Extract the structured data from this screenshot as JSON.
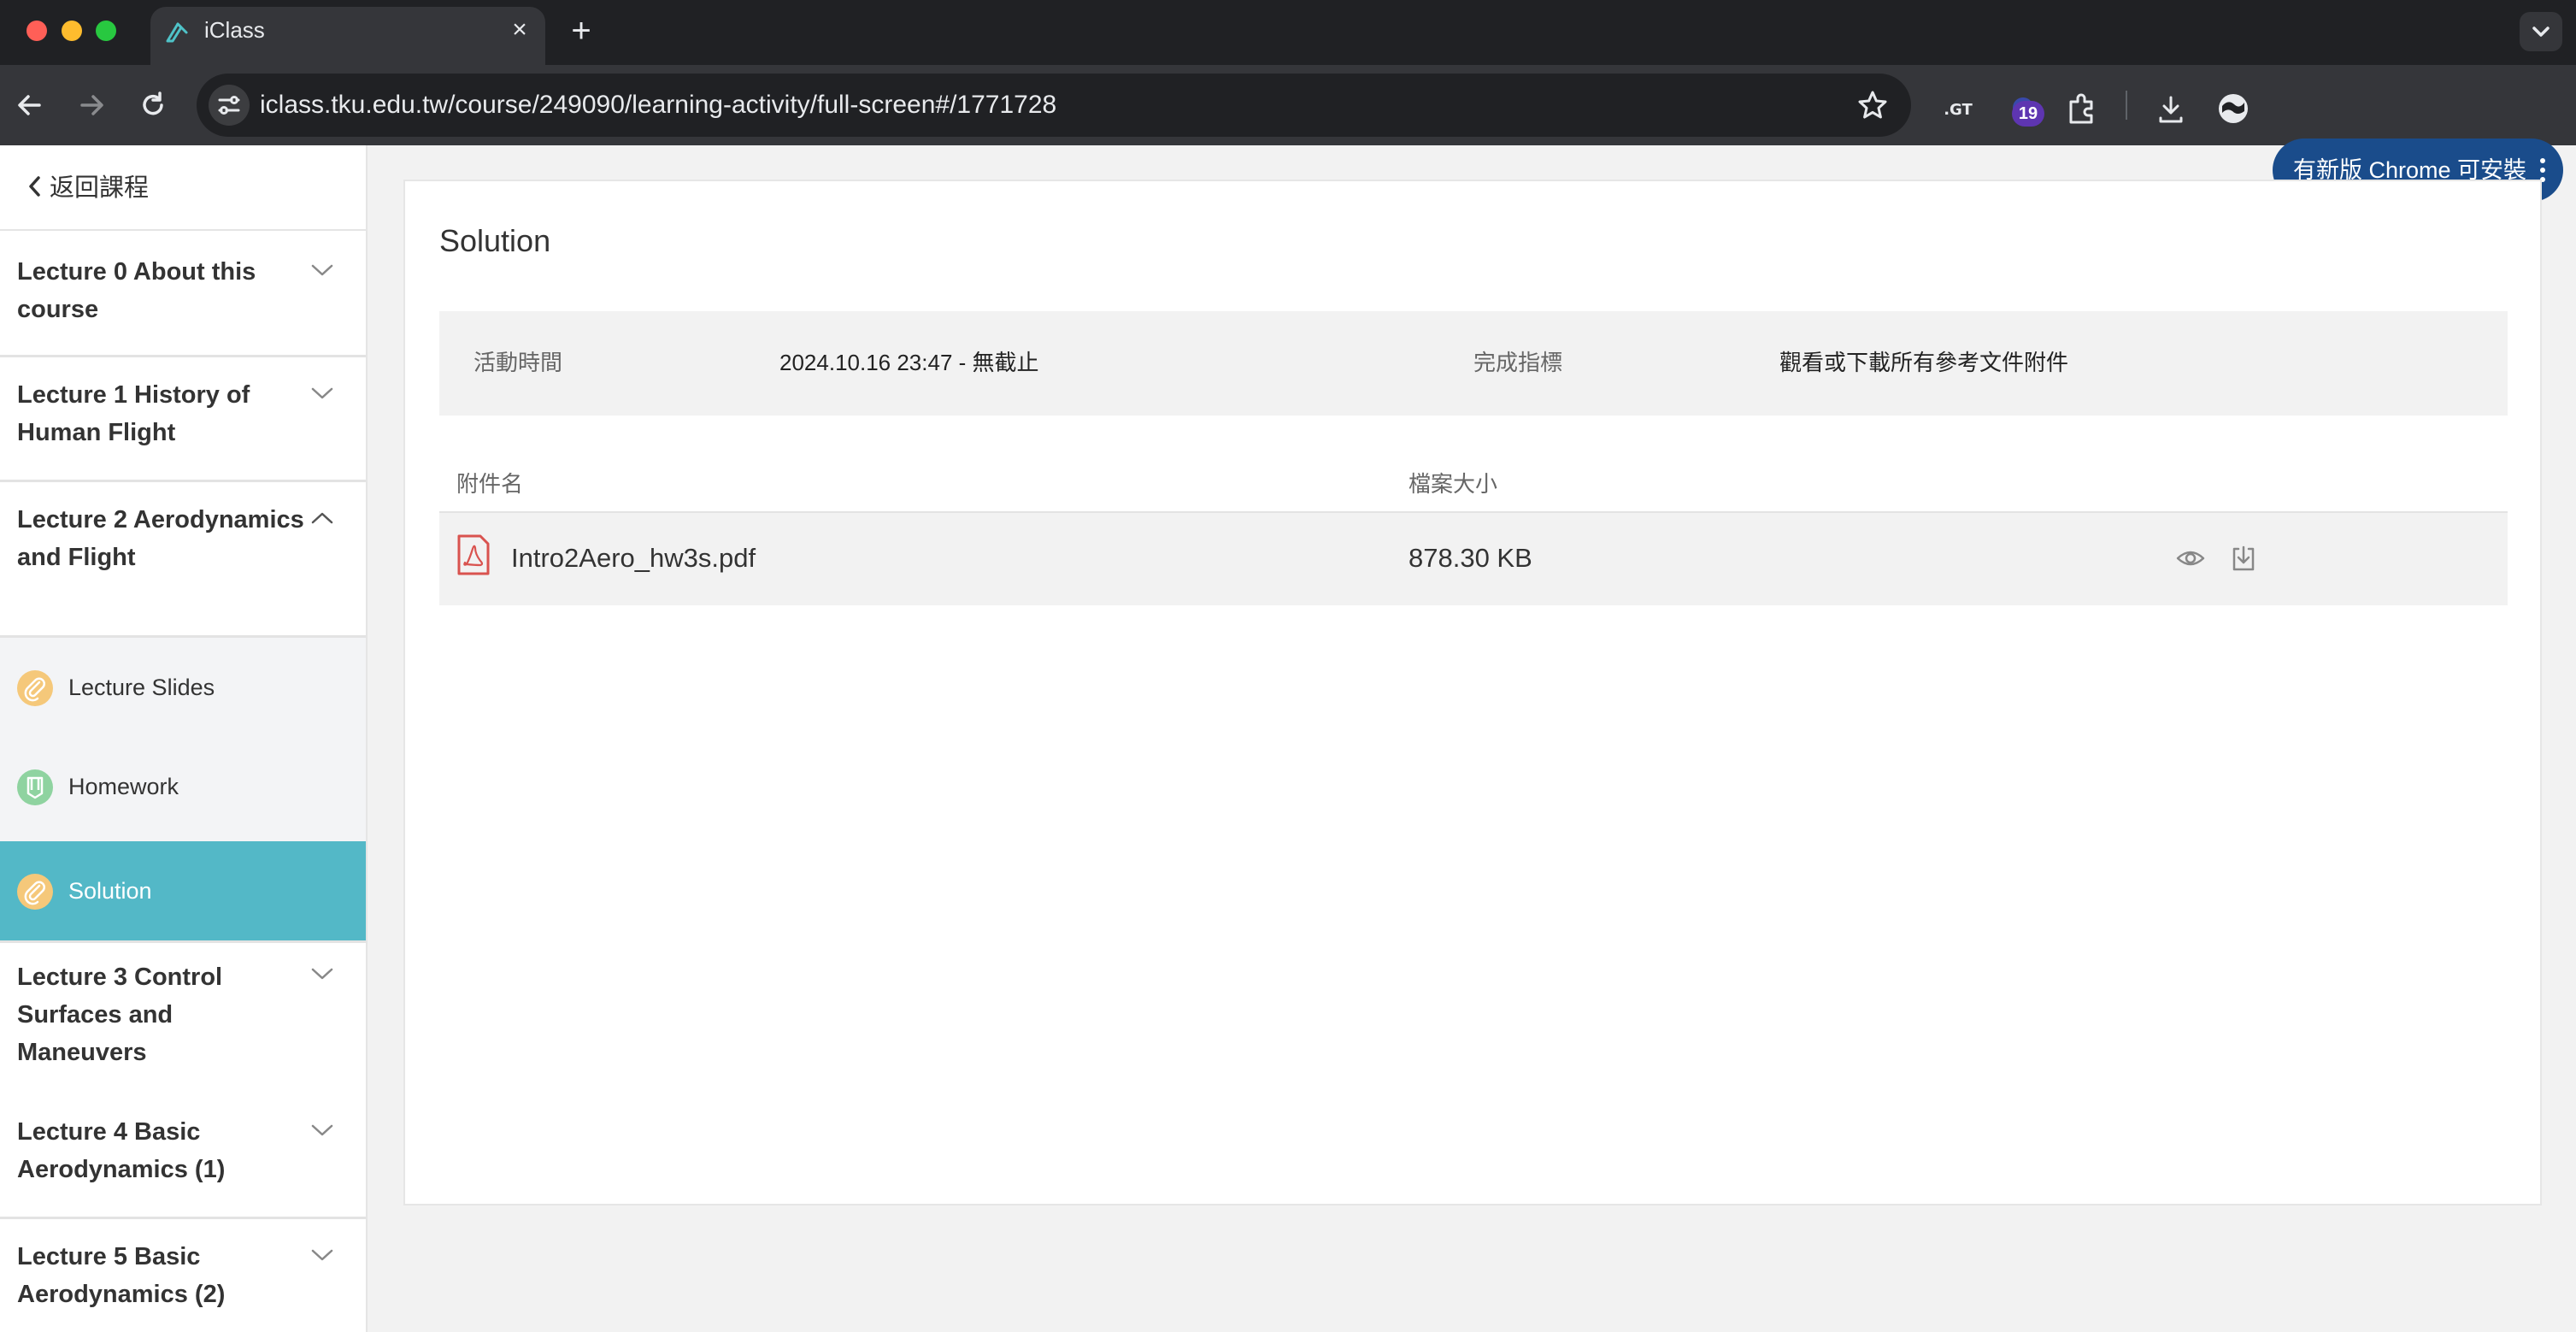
{
  "browser": {
    "tab_title": "iClass",
    "url": "iclass.tku.edu.tw/course/249090/learning-activity/full-screen#/1771728",
    "extension_badge": "19",
    "update_button": "有新版 Chrome 可安裝"
  },
  "sidebar": {
    "back_label": "返回課程",
    "lectures": [
      {
        "title": "Lecture 0 About this course",
        "expanded": false
      },
      {
        "title": "Lecture 1 History of Human Flight",
        "expanded": false
      },
      {
        "title": "Lecture 2 Aerodynamics and Flight",
        "expanded": true,
        "activities": [
          {
            "label": "Lecture Slides",
            "icon": "paperclip-icon",
            "active": false
          },
          {
            "label": "Homework",
            "icon": "homework-icon",
            "active": false
          },
          {
            "label": "Solution",
            "icon": "paperclip-icon",
            "active": true
          }
        ]
      },
      {
        "title": "Lecture 3 Control Surfaces and Maneuvers",
        "expanded": false
      },
      {
        "title": "Lecture 4 Basic Aerodynamics (1)",
        "expanded": false
      },
      {
        "title": "Lecture 5 Basic Aerodynamics (2)",
        "expanded": false
      }
    ]
  },
  "main": {
    "title": "Solution",
    "info": {
      "time_label": "活動時間",
      "time_value": "2024.10.16 23:47 - 無截止",
      "criteria_label": "完成指標",
      "criteria_value": "觀看或下載所有參考文件附件"
    },
    "table": {
      "headers": [
        "附件名",
        "檔案大小"
      ],
      "rows": [
        {
          "name": "Intro2Aero_hw3s.pdf",
          "size": "878.30 KB"
        }
      ]
    }
  },
  "colors": {
    "accent": "#53b8c7",
    "pdf_red": "#d9534f",
    "paperclip_orange": "#f5c87a",
    "homework_green": "#8fd3a0"
  }
}
